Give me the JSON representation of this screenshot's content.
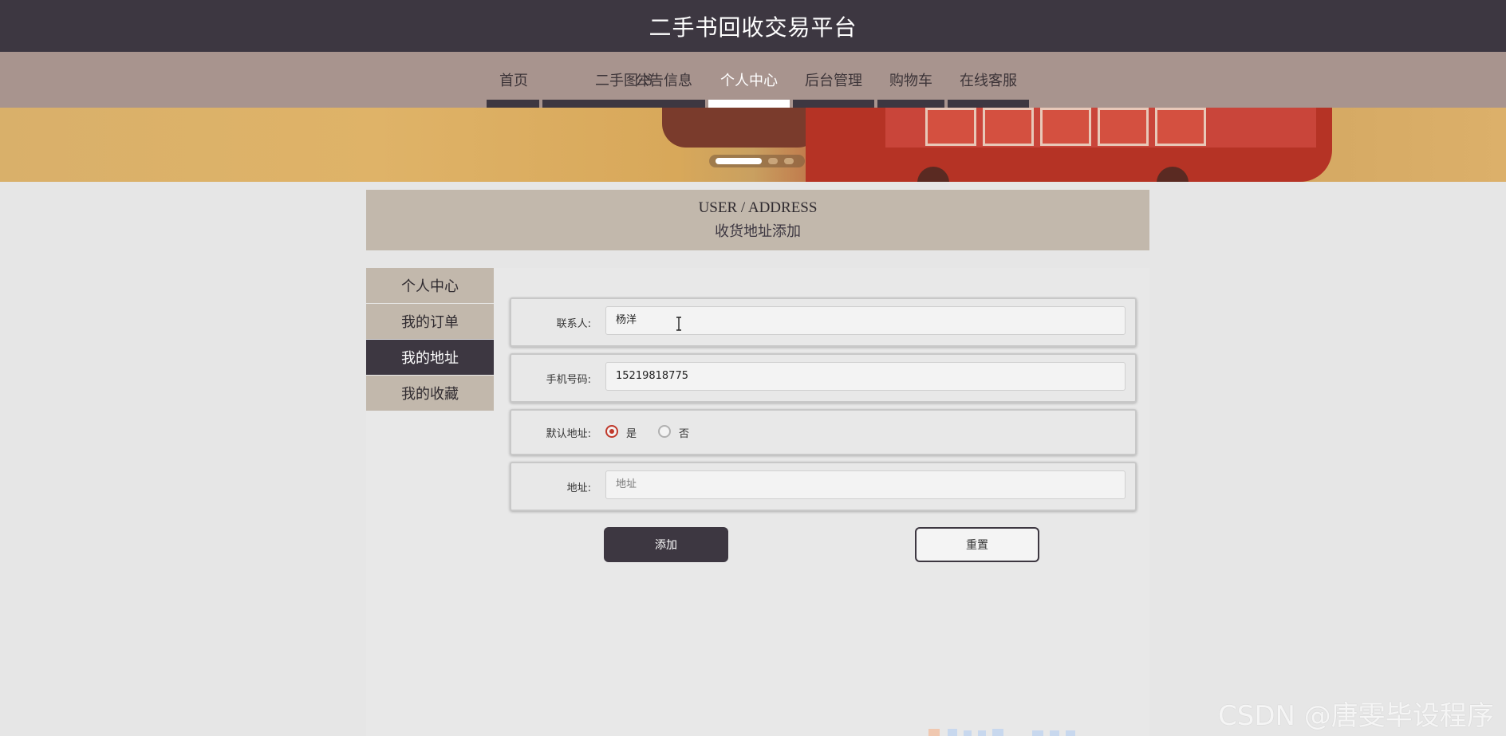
{
  "site": {
    "title": "二手书回收交易平台"
  },
  "nav": {
    "items": [
      {
        "label": "首页",
        "active": false
      },
      {
        "label": "二手图书",
        "active": false
      },
      {
        "label": "公告信息",
        "active": false
      },
      {
        "label": "个人中心",
        "active": true
      },
      {
        "label": "后台管理",
        "active": false
      },
      {
        "label": "购物车",
        "active": false
      },
      {
        "label": "在线客服",
        "active": false
      }
    ]
  },
  "carousel": {
    "active_index": 0,
    "count": 3
  },
  "header": {
    "title_en": "USER / ADDRESS",
    "title_cn": "收货地址添加"
  },
  "sidebar": {
    "items": [
      {
        "label": "个人中心",
        "active": false
      },
      {
        "label": "我的订单",
        "active": false
      },
      {
        "label": "我的地址",
        "active": true
      },
      {
        "label": "我的收藏",
        "active": false
      }
    ]
  },
  "form": {
    "contact": {
      "label": "联系人:",
      "value": "杨洋"
    },
    "phone": {
      "label": "手机号码:",
      "value": "15219818775"
    },
    "default": {
      "label": "默认地址:",
      "options": [
        "是",
        "否"
      ],
      "selected": "是"
    },
    "address": {
      "label": "地址:",
      "value": "",
      "placeholder": "地址"
    },
    "add_label": "添加",
    "reset_label": "重置"
  },
  "colors": {
    "dark": "#3d3741",
    "nav_bg": "#a8948e",
    "panel": "#c2b8ac",
    "radio_accent": "#c0392b"
  },
  "watermark": "CSDN @唐雯毕设程序"
}
